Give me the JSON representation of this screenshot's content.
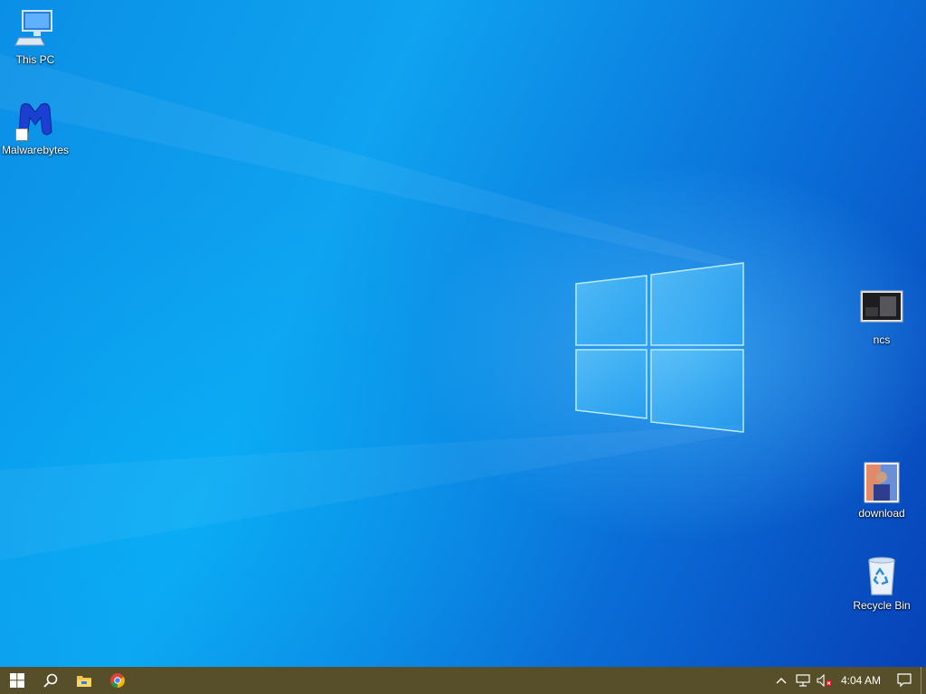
{
  "desktop": {
    "icons": [
      {
        "label": "This PC",
        "icon": "this-pc-icon"
      },
      {
        "label": "Malwarebytes",
        "icon": "malwarebytes-icon"
      },
      {
        "label": "ncs",
        "icon": "image-file-icon"
      },
      {
        "label": "download",
        "icon": "image-file-icon"
      },
      {
        "label": "Recycle Bin",
        "icon": "recycle-bin-icon"
      }
    ]
  },
  "taskbar": {
    "pinned": [
      "start-button",
      "search-button",
      "file-explorer",
      "chrome"
    ],
    "tray": {
      "clock": "4:04 AM",
      "icons": [
        "chevron-up-icon",
        "network-icon",
        "volume-muted-icon",
        "action-center-icon"
      ]
    },
    "colors": {
      "taskbar": "#574f2a",
      "wallpaper_accent": "#0a8fe6"
    }
  }
}
